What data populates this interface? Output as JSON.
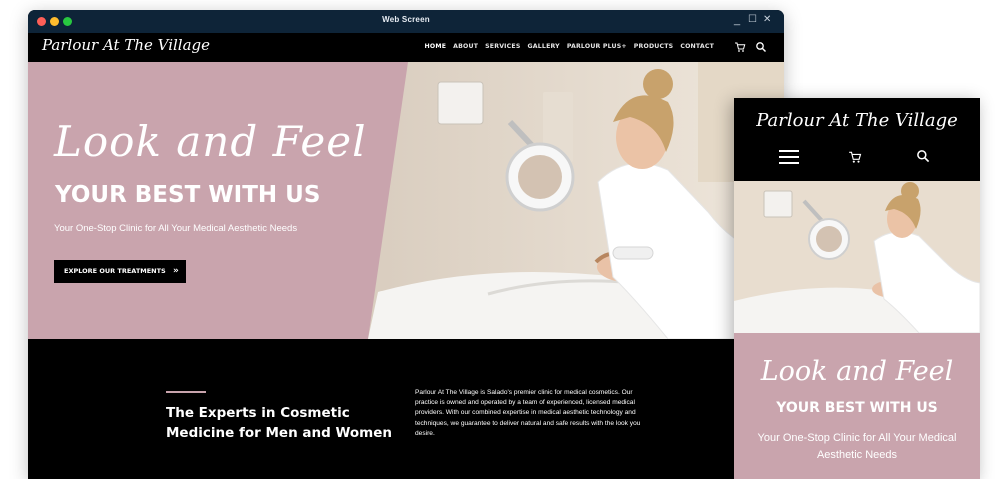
{
  "window": {
    "title": "Web Screen",
    "controls": {
      "minimize": "_",
      "maximize": "☐",
      "close": "✕"
    }
  },
  "site": {
    "logo": "Parlour At The Village",
    "nav": [
      "HOME",
      "ABOUT",
      "SERVICES",
      "GALLERY",
      "PARLOUR PLUS+",
      "PRODUCTS",
      "CONTACT"
    ],
    "active_nav": "HOME",
    "icons": [
      "cart-icon",
      "search-icon",
      "menu-icon"
    ]
  },
  "hero": {
    "script": "Look and Feel",
    "title": "YOUR BEST WITH US",
    "subtitle": "Your One-Stop Clinic for All Your Medical Aesthetic Needs",
    "button": "EXPLORE OUR TREATMENTS",
    "button_icon": "»",
    "photo_alt": "Aesthetician examining a patient's face under a magnifying lamp"
  },
  "about": {
    "title": "The Experts in Cosmetic Medicine for Men and Women",
    "body": "Parlour At The Village is Salado's premier clinic for medical cosmetics. Our practice is owned and operated by a team of experienced, licensed medical providers. With our combined expertise in medical aesthetic technology and techniques, we guarantee to deliver natural and safe results with the look you desire."
  },
  "mobile": {
    "logo": "Parlour At The Village",
    "script": "Look and Feel",
    "title": "YOUR BEST WITH US",
    "subtitle": "Your One-Stop Clinic for All Your Medical Aesthetic Needs"
  },
  "colors": {
    "accent_pink": "#c9a4ad",
    "titlebar": "#0e2438",
    "background_dark": "#000000"
  }
}
